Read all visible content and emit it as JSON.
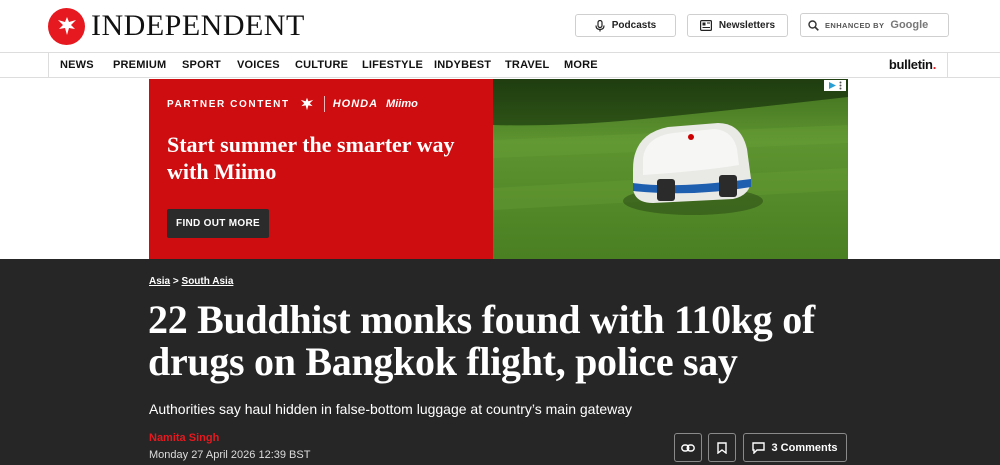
{
  "header": {
    "logo_text": "INDEPENDENT",
    "podcasts_label": "Podcasts",
    "newsletters_label": "Newsletters",
    "search": {
      "enhanced_by": "ENHANCED BY",
      "google": "Google",
      "icon": "search-icon"
    }
  },
  "nav": {
    "items": [
      "NEWS",
      "PREMIUM",
      "SPORT",
      "VOICES",
      "CULTURE",
      "LIFESTYLE",
      "INDYBEST",
      "TRAVEL",
      "MORE"
    ],
    "bulletin": "bulletin",
    "bulletin_dot": "."
  },
  "ad": {
    "partner_label": "PARTNER CONTENT",
    "brand1": "HONDA",
    "brand2": "Miimo",
    "headline": "Start summer the smarter way with Miimo",
    "cta": "FIND OUT MORE"
  },
  "article": {
    "breadcrumb": {
      "level1": "Asia",
      "sep": ">",
      "level2": "South Asia"
    },
    "headline": "22 Buddhist monks found with 110kg of drugs on Bangkok flight, police say",
    "standfirst": "Authorities say haul hidden in false-bottom luggage at country’s main gateway",
    "author": "Namita Singh",
    "date": "Monday 27 April 2026 12:39 BST",
    "comments_label": "3 Comments"
  },
  "colors": {
    "brand_red": "#e5191f",
    "ad_red": "#ce0d10",
    "article_bg": "#262626"
  }
}
